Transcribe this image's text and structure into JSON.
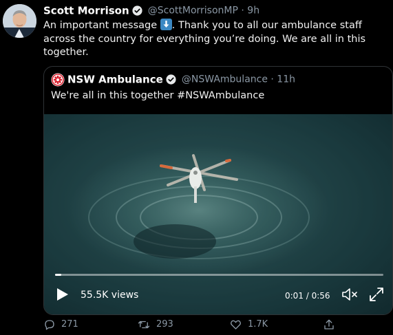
{
  "tweet": {
    "author_name": "Scott Morrison",
    "handle_time": "@ScottMorrisonMP · 9h",
    "text_before_emoji": "An important message ",
    "text_after_emoji": ". Thank you to all our ambulance staff across the country for everything you’re doing. We are all in this together.",
    "emoji": "down-arrow-emoji"
  },
  "quoted": {
    "author_name": "NSW Ambulance",
    "handle_time": "@NSWAmbulance · 11h",
    "text": "We're all in this together #NSWAmbulance",
    "video": {
      "views": "55.5K views",
      "time": "0:01 / 0:56",
      "progress": 0.018
    }
  },
  "actions": {
    "reply_count": "271",
    "retweet_count": "293",
    "like_count": "1.7K"
  },
  "icons": [
    "verified-icon",
    "reply-icon",
    "retweet-icon",
    "like-icon",
    "share-icon",
    "play-icon",
    "mute-icon",
    "fullscreen-icon",
    "nsw-ambulance-logo"
  ],
  "colors": {
    "background": "#000000",
    "secondary_text": "#8b98a5",
    "border": "#2f3336"
  }
}
